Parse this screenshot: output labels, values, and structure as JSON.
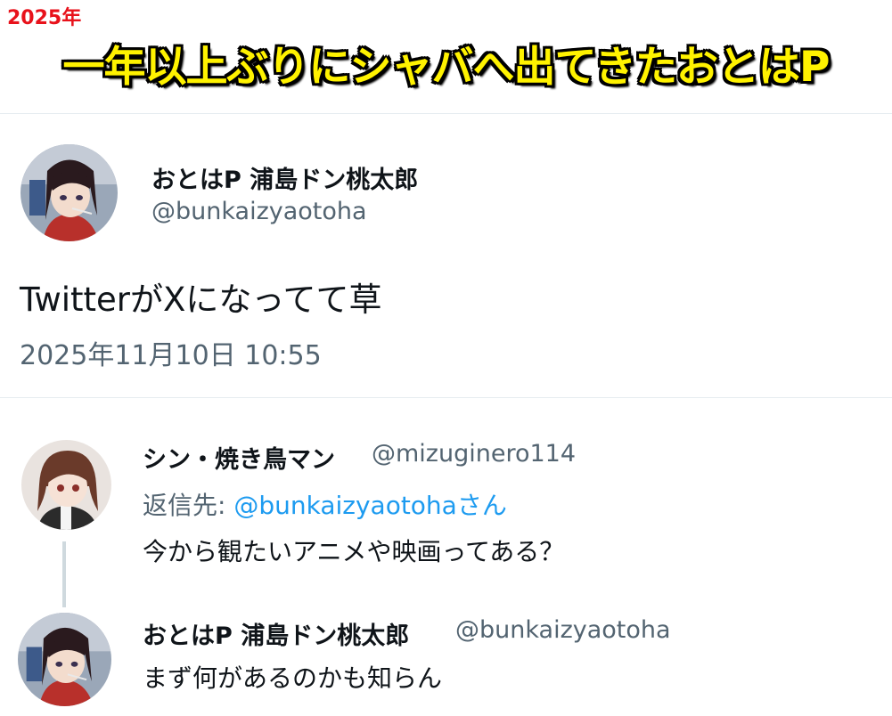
{
  "banner": {
    "year": "2025年",
    "headline": "一年以上ぶりにシャバへ出てきたおとはP"
  },
  "main_tweet": {
    "display_name": "おとはP 浦島ドン桃太郎",
    "handle": "@bunkaizyaotoha",
    "text": "TwitterがXになってて草",
    "timestamp": "2025年11月10日 10:55",
    "avatar_icon": "anime-girl-avatar-icon"
  },
  "reply_1": {
    "display_name": "シン・焼き鳥マン",
    "handle": "@mizuginero114",
    "reply_to_prefix": "返信先: ",
    "reply_to_handle": "@bunkaizyaotohaさん",
    "text": "今から観たいアニメや映画ってある？",
    "avatar_icon": "brown-hair-girl-avatar-icon"
  },
  "reply_2": {
    "display_name": "おとはP 浦島ドン桃太郎",
    "handle": "@bunkaizyaotoha",
    "text": "まず何があるのかも知らん",
    "avatar_icon": "anime-girl-avatar-icon"
  },
  "colors": {
    "link": "#1d9bf0",
    "muted": "#536471",
    "headline_fill": "#fff200",
    "year_red": "#e8121b"
  }
}
